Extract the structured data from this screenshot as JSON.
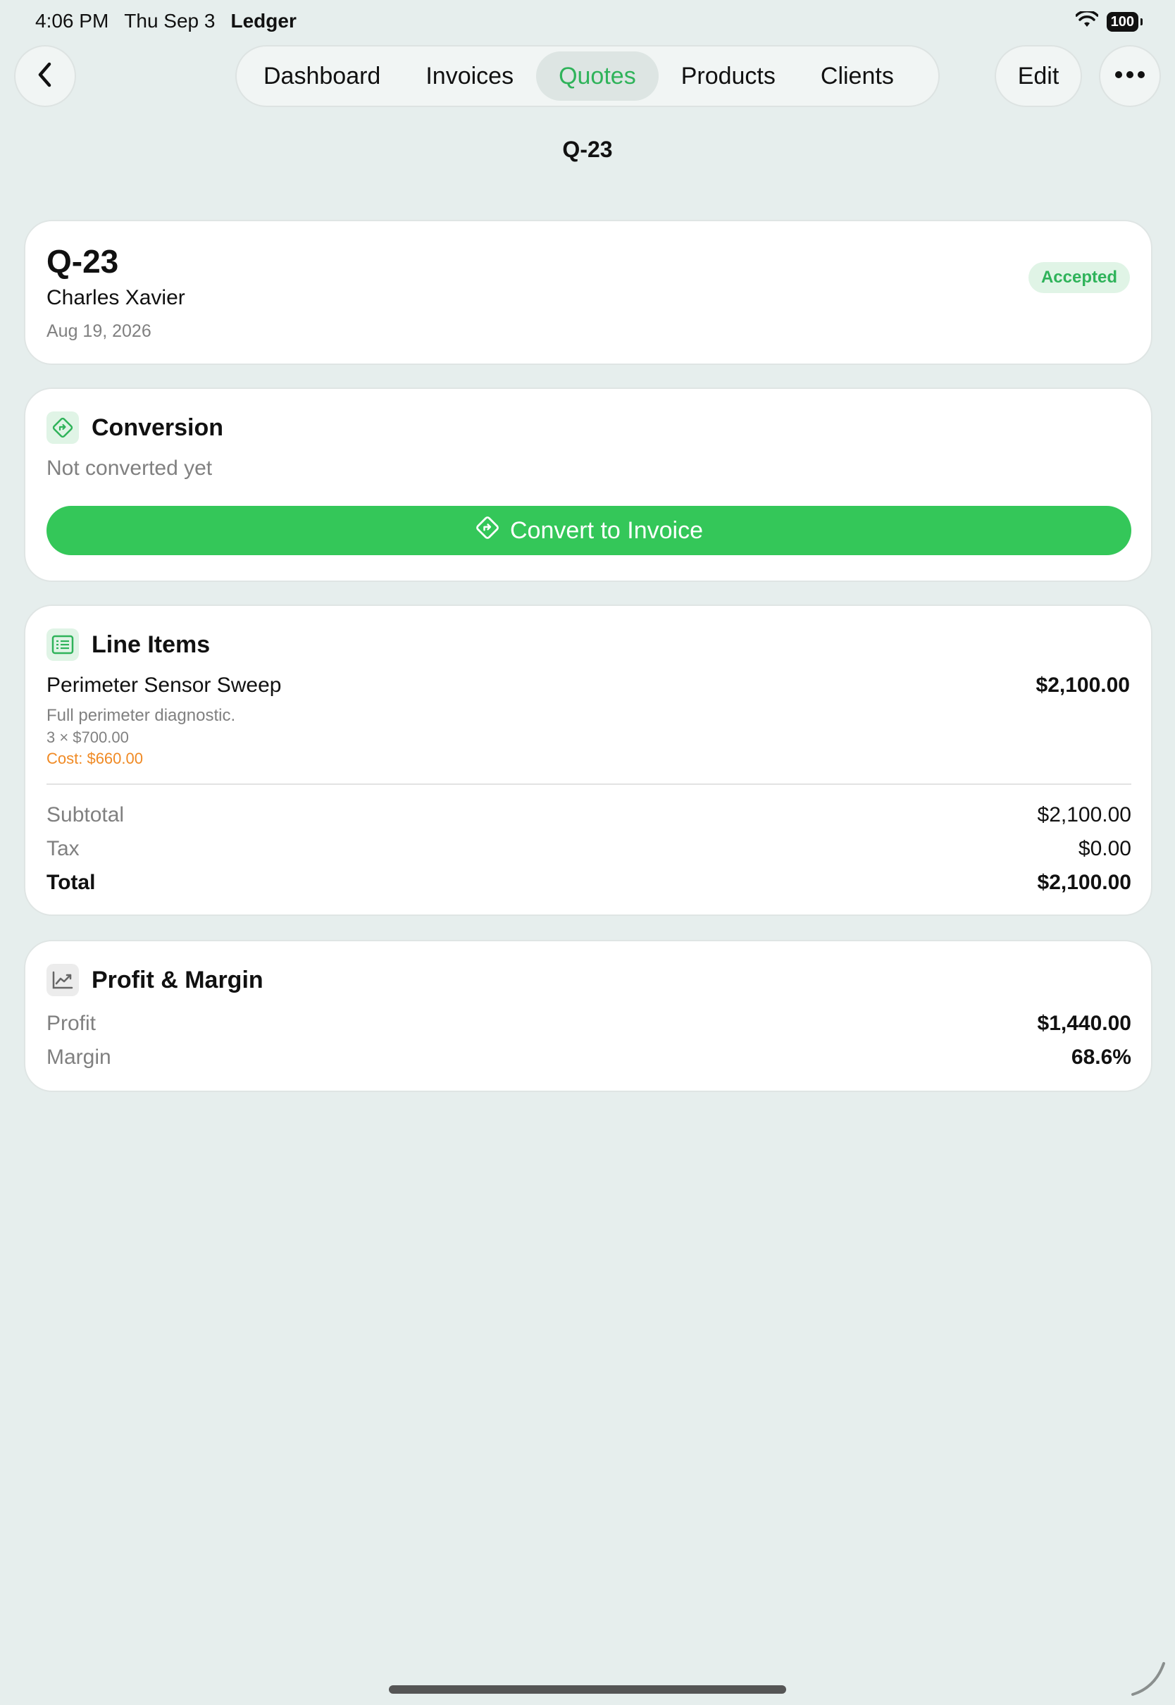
{
  "status_bar": {
    "time": "4:06 PM",
    "date": "Thu Sep 3",
    "app": "Ledger",
    "battery": "100"
  },
  "nav": {
    "tabs": [
      {
        "label": "Dashboard"
      },
      {
        "label": "Invoices"
      },
      {
        "label": "Quotes"
      },
      {
        "label": "Products"
      },
      {
        "label": "Clients"
      }
    ],
    "active_tab": "Quotes",
    "edit_label": "Edit",
    "title": "Q-23"
  },
  "quote": {
    "number": "Q-23",
    "client": "Charles Xavier",
    "date": "Aug 19, 2026",
    "status": "Accepted"
  },
  "conversion": {
    "title": "Conversion",
    "status": "Not converted yet",
    "button_label": "Convert to Invoice"
  },
  "line_items": {
    "title": "Line Items",
    "items": [
      {
        "name": "Perimeter Sensor Sweep",
        "description": "Full perimeter diagnostic.",
        "qty_price": "3 × $700.00",
        "cost": "Cost: $660.00",
        "amount": "$2,100.00"
      }
    ],
    "subtotal_label": "Subtotal",
    "subtotal": "$2,100.00",
    "tax_label": "Tax",
    "tax": "$0.00",
    "total_label": "Total",
    "total": "$2,100.00"
  },
  "profit": {
    "title": "Profit & Margin",
    "profit_label": "Profit",
    "profit": "$1,440.00",
    "margin_label": "Margin",
    "margin": "68.6%"
  },
  "colors": {
    "accent": "#34c759",
    "accent_text": "#2fb35a",
    "cost": "#f08a24",
    "background": "#e6eeed"
  },
  "icons": {
    "back": "chevron-left-icon",
    "more": "ellipsis-icon",
    "conversion": "arrow-turn-right-diamond-icon",
    "line_items": "list-icon",
    "profit": "chart-line-icon",
    "wifi": "wifi-icon",
    "battery": "battery-icon"
  }
}
